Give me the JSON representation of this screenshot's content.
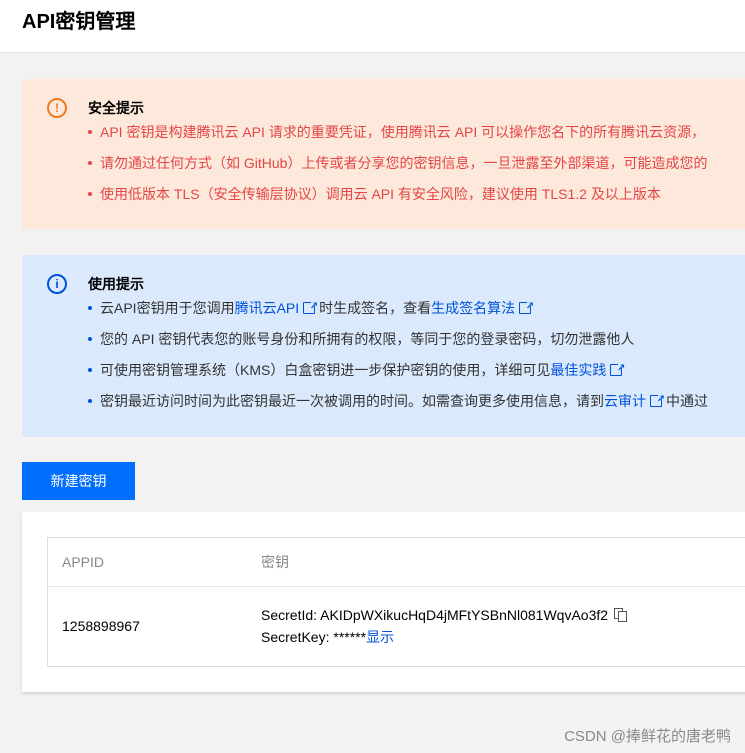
{
  "header": {
    "title": "API密钥管理"
  },
  "security_notice": {
    "title": "安全提示",
    "items": [
      "API 密钥是构建腾讯云 API 请求的重要凭证，使用腾讯云 API 可以操作您名下的所有腾讯云资源，",
      "请勿通过任何方式（如 GitHub）上传或者分享您的密钥信息，一旦泄露至外部渠道，可能造成您的",
      "使用低版本 TLS（安全传输层协议）调用云 API 有安全风险，建议使用 TLS1.2 及以上版本"
    ],
    "accent_color": "#f07b1d"
  },
  "usage_notice": {
    "title": "使用提示",
    "item1": {
      "pre": "云API密钥用于您调用",
      "link1": "腾讯云API",
      "mid": "时生成签名，查看",
      "link2": "生成签名算法"
    },
    "item2": "您的 API 密钥代表您的账号身份和所拥有的权限，等同于您的登录密码，切勿泄露他人",
    "item3": {
      "pre": "可使用密钥管理系统（KMS）白盒密钥进一步保护密钥的使用，详细可见",
      "link": "最佳实践"
    },
    "item4": {
      "pre": "密钥最近访问时间为此密钥最近一次被调用的时间。如需查询更多使用信息，请到",
      "link": "云审计",
      "post": "中通过"
    },
    "accent_color": "#0052d9"
  },
  "new_key_button": "新建密钥",
  "table": {
    "headers": {
      "appid": "APPID",
      "key": "密钥"
    },
    "rows": [
      {
        "appid": "1258898967",
        "secret_id_label": "SecretId: ",
        "secret_id": "AKIDpWXikucHqD4jMFtYSBnNl081WqvAo3f2",
        "secret_key_label": "SecretKey: ",
        "secret_key": "******",
        "show_link": "显示"
      }
    ]
  },
  "watermark": "CSDN @捧鲜花的唐老鸭"
}
